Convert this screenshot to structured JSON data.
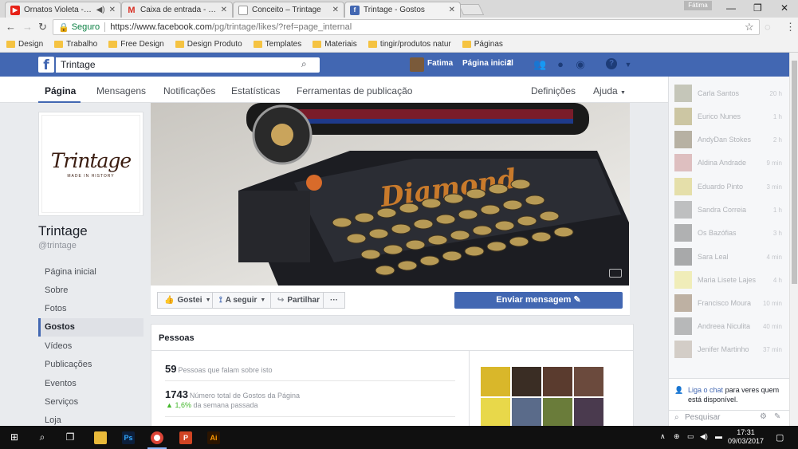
{
  "browser": {
    "tabs": [
      {
        "title": "Ornatos Violeta - Cão",
        "favicon": "youtube-icon",
        "color": "#e62117"
      },
      {
        "title": "Caixa de entrada - fatima",
        "favicon": "gmail-icon",
        "color": "#d93025"
      },
      {
        "title": "Conceito – Trintage",
        "favicon": "page-icon",
        "color": "#999999"
      },
      {
        "title": "Trintage - Gostos",
        "favicon": "facebook-icon",
        "color": "#4267b2"
      }
    ],
    "user_chip": "Fátima",
    "url_secure": "Seguro",
    "url_host": "https://www.facebook.com",
    "url_path": "/pg/trintage/likes/?ref=page_internal",
    "bookmarks": [
      "Design",
      "Trabalho",
      "Free Design",
      "Design Produto",
      "Templates",
      "Materiais",
      "tingir/produtos natur",
      "Páginas"
    ]
  },
  "fb": {
    "search_value": "Trintage",
    "user_name": "Fatima",
    "home_label": "Página inicial",
    "home_count": "2",
    "brand_color": "#4267b2"
  },
  "page_nav": {
    "tabs": [
      "Página",
      "Mensagens",
      "Notificações",
      "Estatísticas",
      "Ferramentas de publicação"
    ],
    "settings": "Definições",
    "help": "Ajuda"
  },
  "page": {
    "logo_text": "Trintage",
    "logo_sub": "MADE IN HISTORY",
    "name": "Trintage",
    "handle": "@trintage",
    "left_nav": [
      "Página inicial",
      "Sobre",
      "Fotos",
      "Gostos",
      "Vídeos",
      "Publicações",
      "Eventos",
      "Serviços",
      "Loja"
    ],
    "cover_brand": "Diamond"
  },
  "actions": {
    "liked": "Gostei",
    "following": "A seguir",
    "share": "Partilhar",
    "more": "···",
    "send_message": "Enviar mensagem"
  },
  "people": {
    "title": "Pessoas",
    "talking_count": "59",
    "talking_label": "Pessoas que falam sobre isto",
    "likes_count": "1743",
    "likes_label": "Número total de Gostos da Página",
    "trend_value": "1,6%",
    "trend_label": "da semana passada"
  },
  "chat": {
    "contacts": [
      {
        "name": "Carla Santos",
        "time": "20 h"
      },
      {
        "name": "Eurico Nunes",
        "time": "1 h"
      },
      {
        "name": "AndyDan Stokes",
        "time": "2 h"
      },
      {
        "name": "Aldina Andrade",
        "time": "9 min"
      },
      {
        "name": "Eduardo Pinto",
        "time": "3 min"
      },
      {
        "name": "Sandra Correia",
        "time": "1 h"
      },
      {
        "name": "Os Bazófias",
        "time": "3 h"
      },
      {
        "name": "Sara Leal",
        "time": "4 min"
      },
      {
        "name": "Maria Lisete Lajes",
        "time": "4 h"
      },
      {
        "name": "Francisco Moura",
        "time": "10 min"
      },
      {
        "name": "Andreea Niculita",
        "time": "40 min"
      },
      {
        "name": "Jenifer Martinho",
        "time": "37 min"
      }
    ],
    "enable_link": "Liga o chat",
    "enable_text": "para veres quem está disponível.",
    "search_placeholder": "Pesquisar"
  },
  "taskbar": {
    "time": "17:31",
    "date": "09/03/2017"
  }
}
